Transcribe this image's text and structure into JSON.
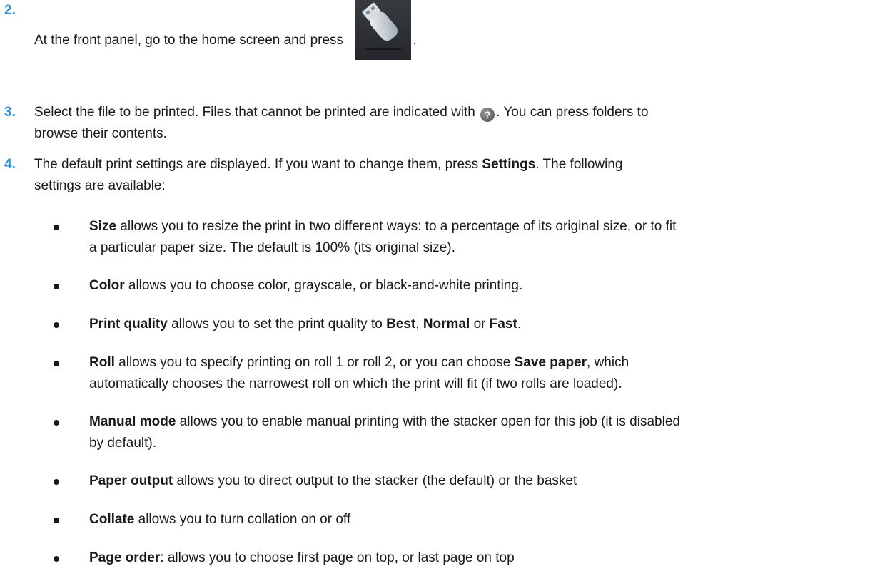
{
  "steps": [
    {
      "num": "2.",
      "pre": "At the front panel, go to the home screen and press ",
      "post": ".",
      "icon": "usb-icon"
    },
    {
      "num": "3.",
      "line1_pre": "Select the file to be printed. Files that cannot be printed are indicated with ",
      "line1_post": ". You can press folders to",
      "line2": "browse their contents.",
      "icon": "help-icon"
    },
    {
      "num": "4.",
      "line1_pre": "The default print settings are displayed. If you want to change them, press ",
      "line1_bold": "Settings",
      "line1_post": ". The following",
      "line2": "settings are available:"
    }
  ],
  "bullets": [
    {
      "bold": "Size",
      "line1": " allows you to resize the print in two different ways: to a percentage of its original size, or to fit",
      "line2": "a particular paper size. The default is 100% (its original size)."
    },
    {
      "bold": "Color",
      "line1": " allows you to choose color, grayscale, or black-and-white printing."
    },
    {
      "bold": "Print quality",
      "line1": " allows you to set the print quality to ",
      "b1": "Best",
      "sep1": ", ",
      "b2": "Normal",
      "sep2": " or ",
      "b3": "Fast",
      "end": "."
    },
    {
      "bold": "Roll",
      "line1": " allows you to specify printing on roll 1 or roll 2, or you can choose ",
      "b1": "Save paper",
      "line1_post": ", which",
      "line2": "automatically chooses the narrowest roll on which the print will fit (if two rolls are loaded)."
    },
    {
      "bold": "Manual mode",
      "line1": " allows you to enable manual printing with the stacker open for this job (it is disabled",
      "line2": "by default)."
    },
    {
      "bold": "Paper output",
      "line1": " allows you to direct output to the stacker (the default) or the basket"
    },
    {
      "bold": "Collate",
      "line1": " allows you to turn collation on or off"
    },
    {
      "bold": "Page order",
      "line1": ": allows you to choose first page on top, or last page on top"
    }
  ],
  "colors": {
    "step_number": "#2e8fd6",
    "text": "#1a1a1a",
    "icon_tile": "#2b2e33"
  }
}
